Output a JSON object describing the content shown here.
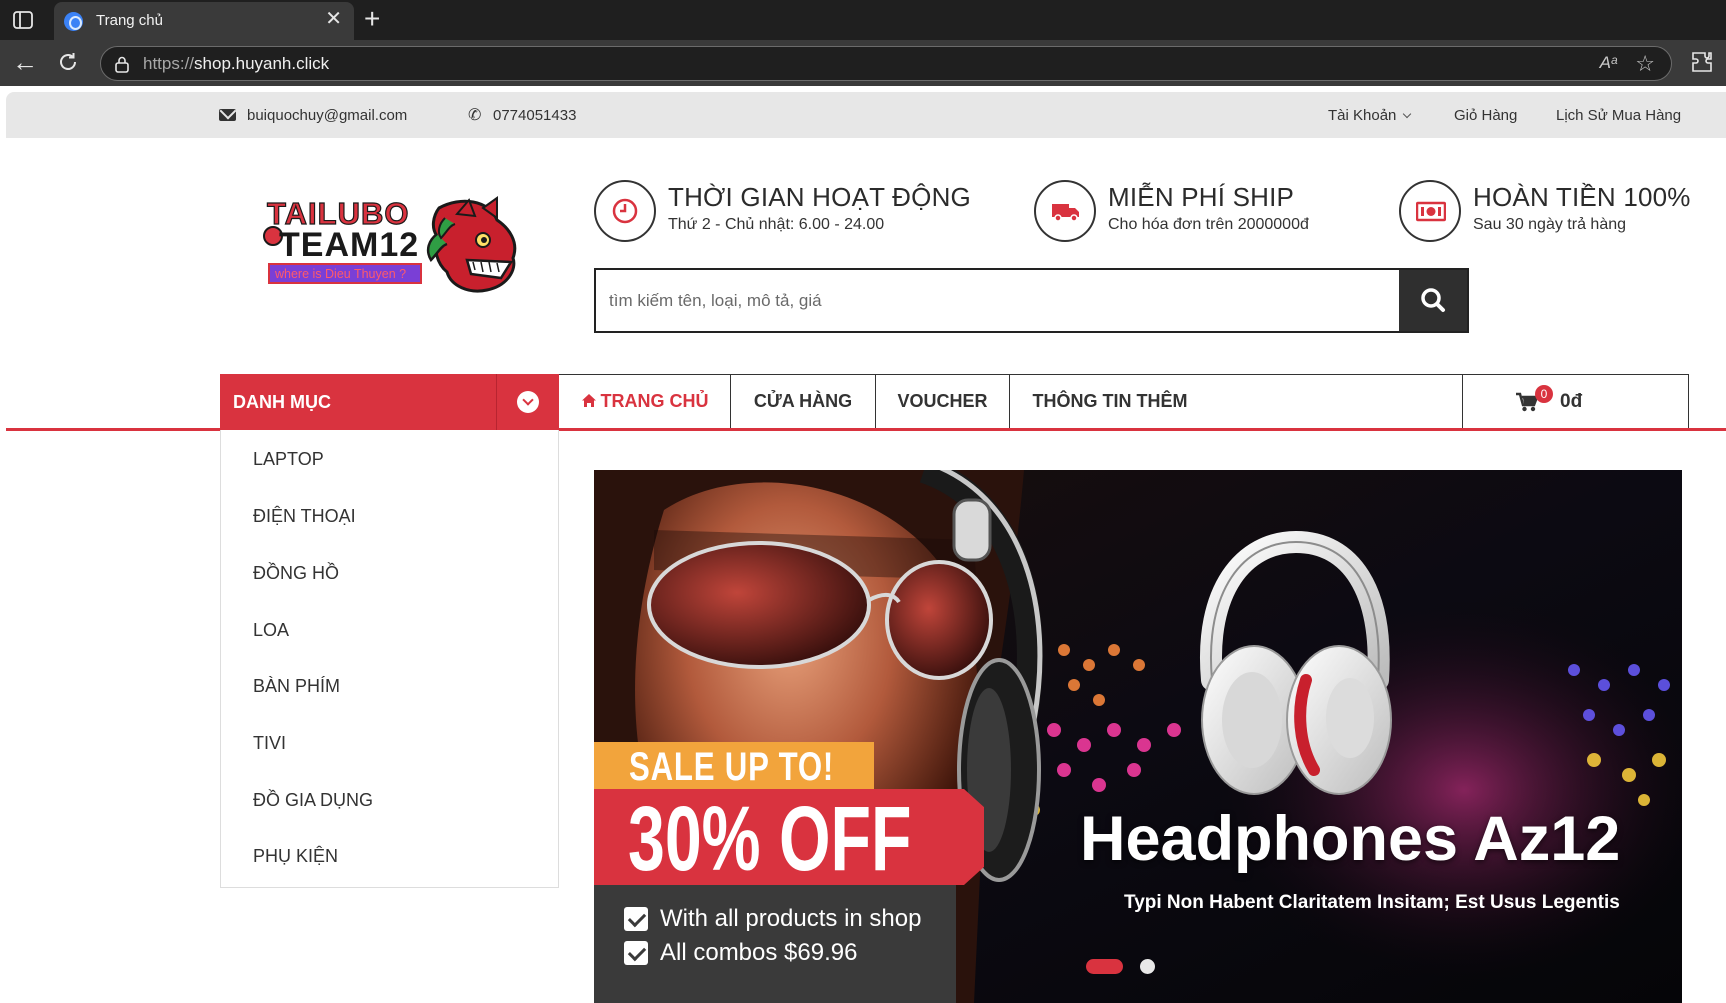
{
  "browser": {
    "tab_title": "Trang chủ",
    "url_scheme": "https://",
    "url_host": "shop.huyanh.click",
    "read_aloud": "Aᵃ"
  },
  "topbar": {
    "email": "buiquochuy@gmail.com",
    "phone": "0774051433",
    "account": "Tài Khoản",
    "cart": "Giỏ Hàng",
    "history": "Lịch Sử Mua Hàng"
  },
  "logo": {
    "line1": "TAILUBO",
    "line2": "TEAM12",
    "tagline": "where is Dieu Thuyen ?"
  },
  "features": [
    {
      "title": "THỜI GIAN HOẠT ĐỘNG",
      "sub": "Thứ 2 - Chủ nhật: 6.00 - 24.00",
      "icon": "clock-icon"
    },
    {
      "title": "MIỄN PHÍ SHIP",
      "sub": "Cho hóa đơn trên 2000000đ",
      "icon": "truck-icon"
    },
    {
      "title": "HOÀN TIỀN 100%",
      "sub": "Sau 30 ngày trả hàng",
      "icon": "money-icon"
    }
  ],
  "search": {
    "placeholder": "tìm kiếm tên, loại, mô tả, giá"
  },
  "nav": {
    "category_label": "DANH MỤC",
    "items": [
      "TRANG CHỦ",
      "CỬA HÀNG",
      "VOUCHER",
      "THÔNG TIN THÊM"
    ],
    "cart_count": "0",
    "cart_total": "0đ"
  },
  "categories": [
    "LAPTOP",
    "ĐIỆN THOẠI",
    "ĐỒNG HỒ",
    "LOA",
    "BÀN PHÍM",
    "TIVI",
    "ĐỒ GIA DỤNG",
    "PHỤ KIỆN"
  ],
  "banner": {
    "sale": "SALE UP TO!",
    "off": "30% OFF",
    "lines": [
      "With all products in shop",
      "All combos $69.96"
    ],
    "title": "Headphones Az12",
    "subtitle": "Typi Non Habent Claritatem Insitam; Est Usus Legentis",
    "slide_count": 2,
    "active_slide": 1
  },
  "colors": {
    "accent": "#d9333f",
    "sale_orange": "#f2a43c",
    "dark": "#2f2f2f"
  }
}
